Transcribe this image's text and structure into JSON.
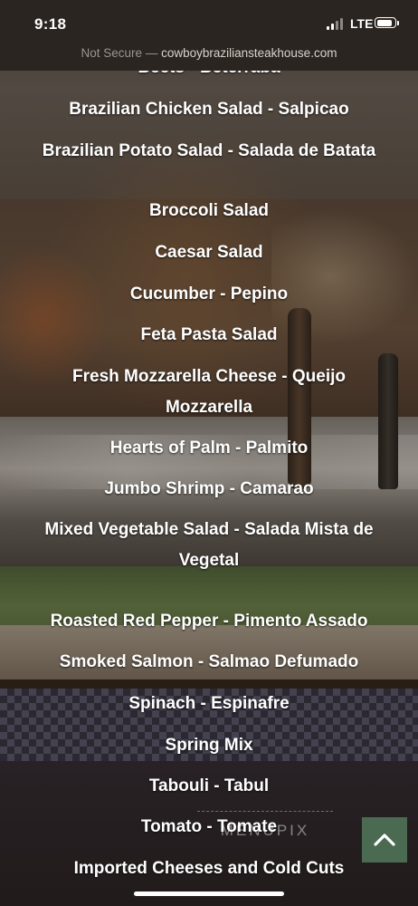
{
  "status_bar": {
    "time": "9:18",
    "network": "LTE",
    "battery_level": 0.9
  },
  "browser": {
    "security_label": "Not Secure —",
    "host": "cowboybraziliansteakhouse.com"
  },
  "menu": {
    "items": [
      "Beets - Beterraba",
      "Brazilian Chicken Salad - Salpicao",
      "Brazilian Potato Salad - Salada de Batata",
      "Broccoli Salad",
      "Caesar Salad",
      "Cucumber - Pepino",
      "Feta Pasta Salad",
      "Fresh Mozzarella Cheese - Queijo Mozzarella",
      "Hearts of Palm - Palmito",
      "Jumbo Shrimp - Camarao",
      "Mixed Vegetable Salad - Salada Mista de Vegetal",
      "Roasted Red Pepper - Pimento Assado",
      "Smoked Salmon - Salmao Defumado",
      "Spinach - Espinafre",
      "Spring Mix",
      "Tabouli - Tabul",
      "Tomato - Tomate",
      "Imported Cheeses and Cold Cuts"
    ]
  },
  "watermark": "MENUPIX",
  "icons": {
    "back_to_top": "chevron-up-icon"
  },
  "colors": {
    "back_to_top_bg": "#4b6a52",
    "bar_bg": "#2b2521"
  }
}
